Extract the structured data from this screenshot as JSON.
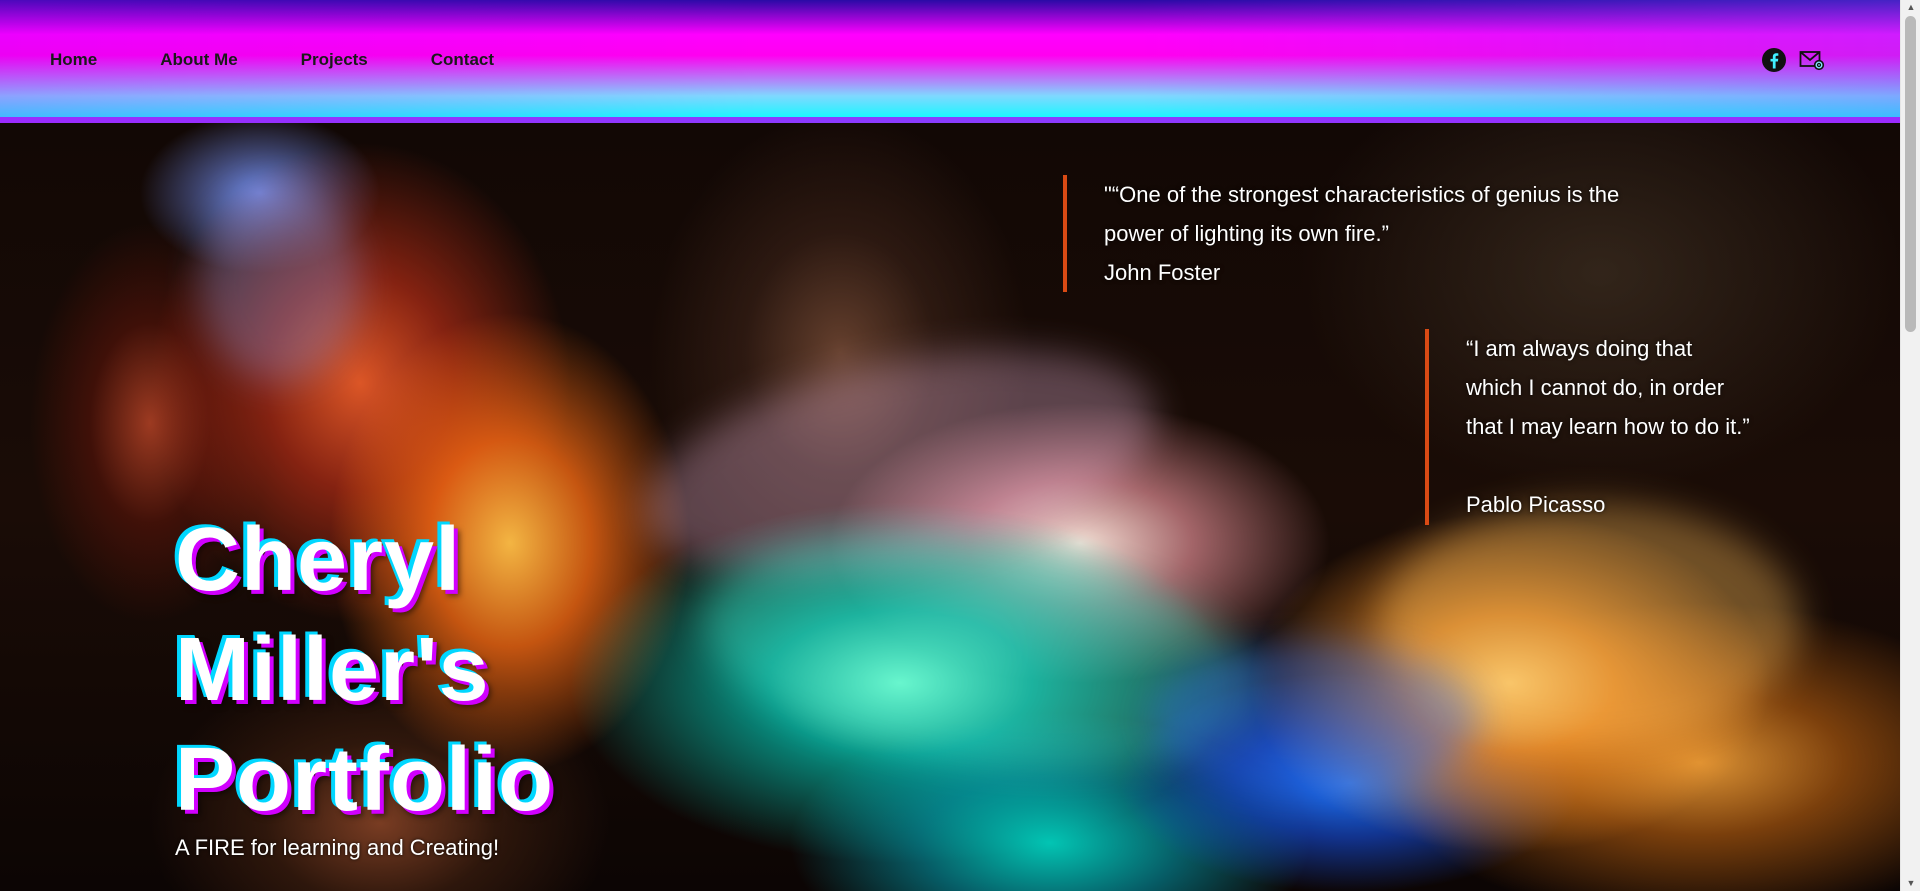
{
  "nav": {
    "items": [
      {
        "label": "Home"
      },
      {
        "label": "About Me"
      },
      {
        "label": "Projects"
      },
      {
        "label": "Contact"
      }
    ]
  },
  "social": {
    "icons": [
      "facebook-icon",
      "email-icon"
    ]
  },
  "quotes": [
    {
      "text_line1": "\"“One of the strongest characteristics of genius is the",
      "text_line2": "power of lighting its own fire.”",
      "author": "John Foster"
    },
    {
      "text_line1": "“I am always doing that",
      "text_line2": "which I cannot do, in order",
      "text_line3": "that I may learn how to do it.”",
      "author": "Pablo Picasso"
    }
  ],
  "hero": {
    "title_line1": "Cheryl",
    "title_line2": "Miller's",
    "title_line3": "Portfolio",
    "subtitle": "A FIRE for learning and Creating!"
  },
  "colors": {
    "quote_border": "#d94a14",
    "header_gradient_top": "#ff00ff",
    "header_gradient_bottom": "#00ffff"
  }
}
